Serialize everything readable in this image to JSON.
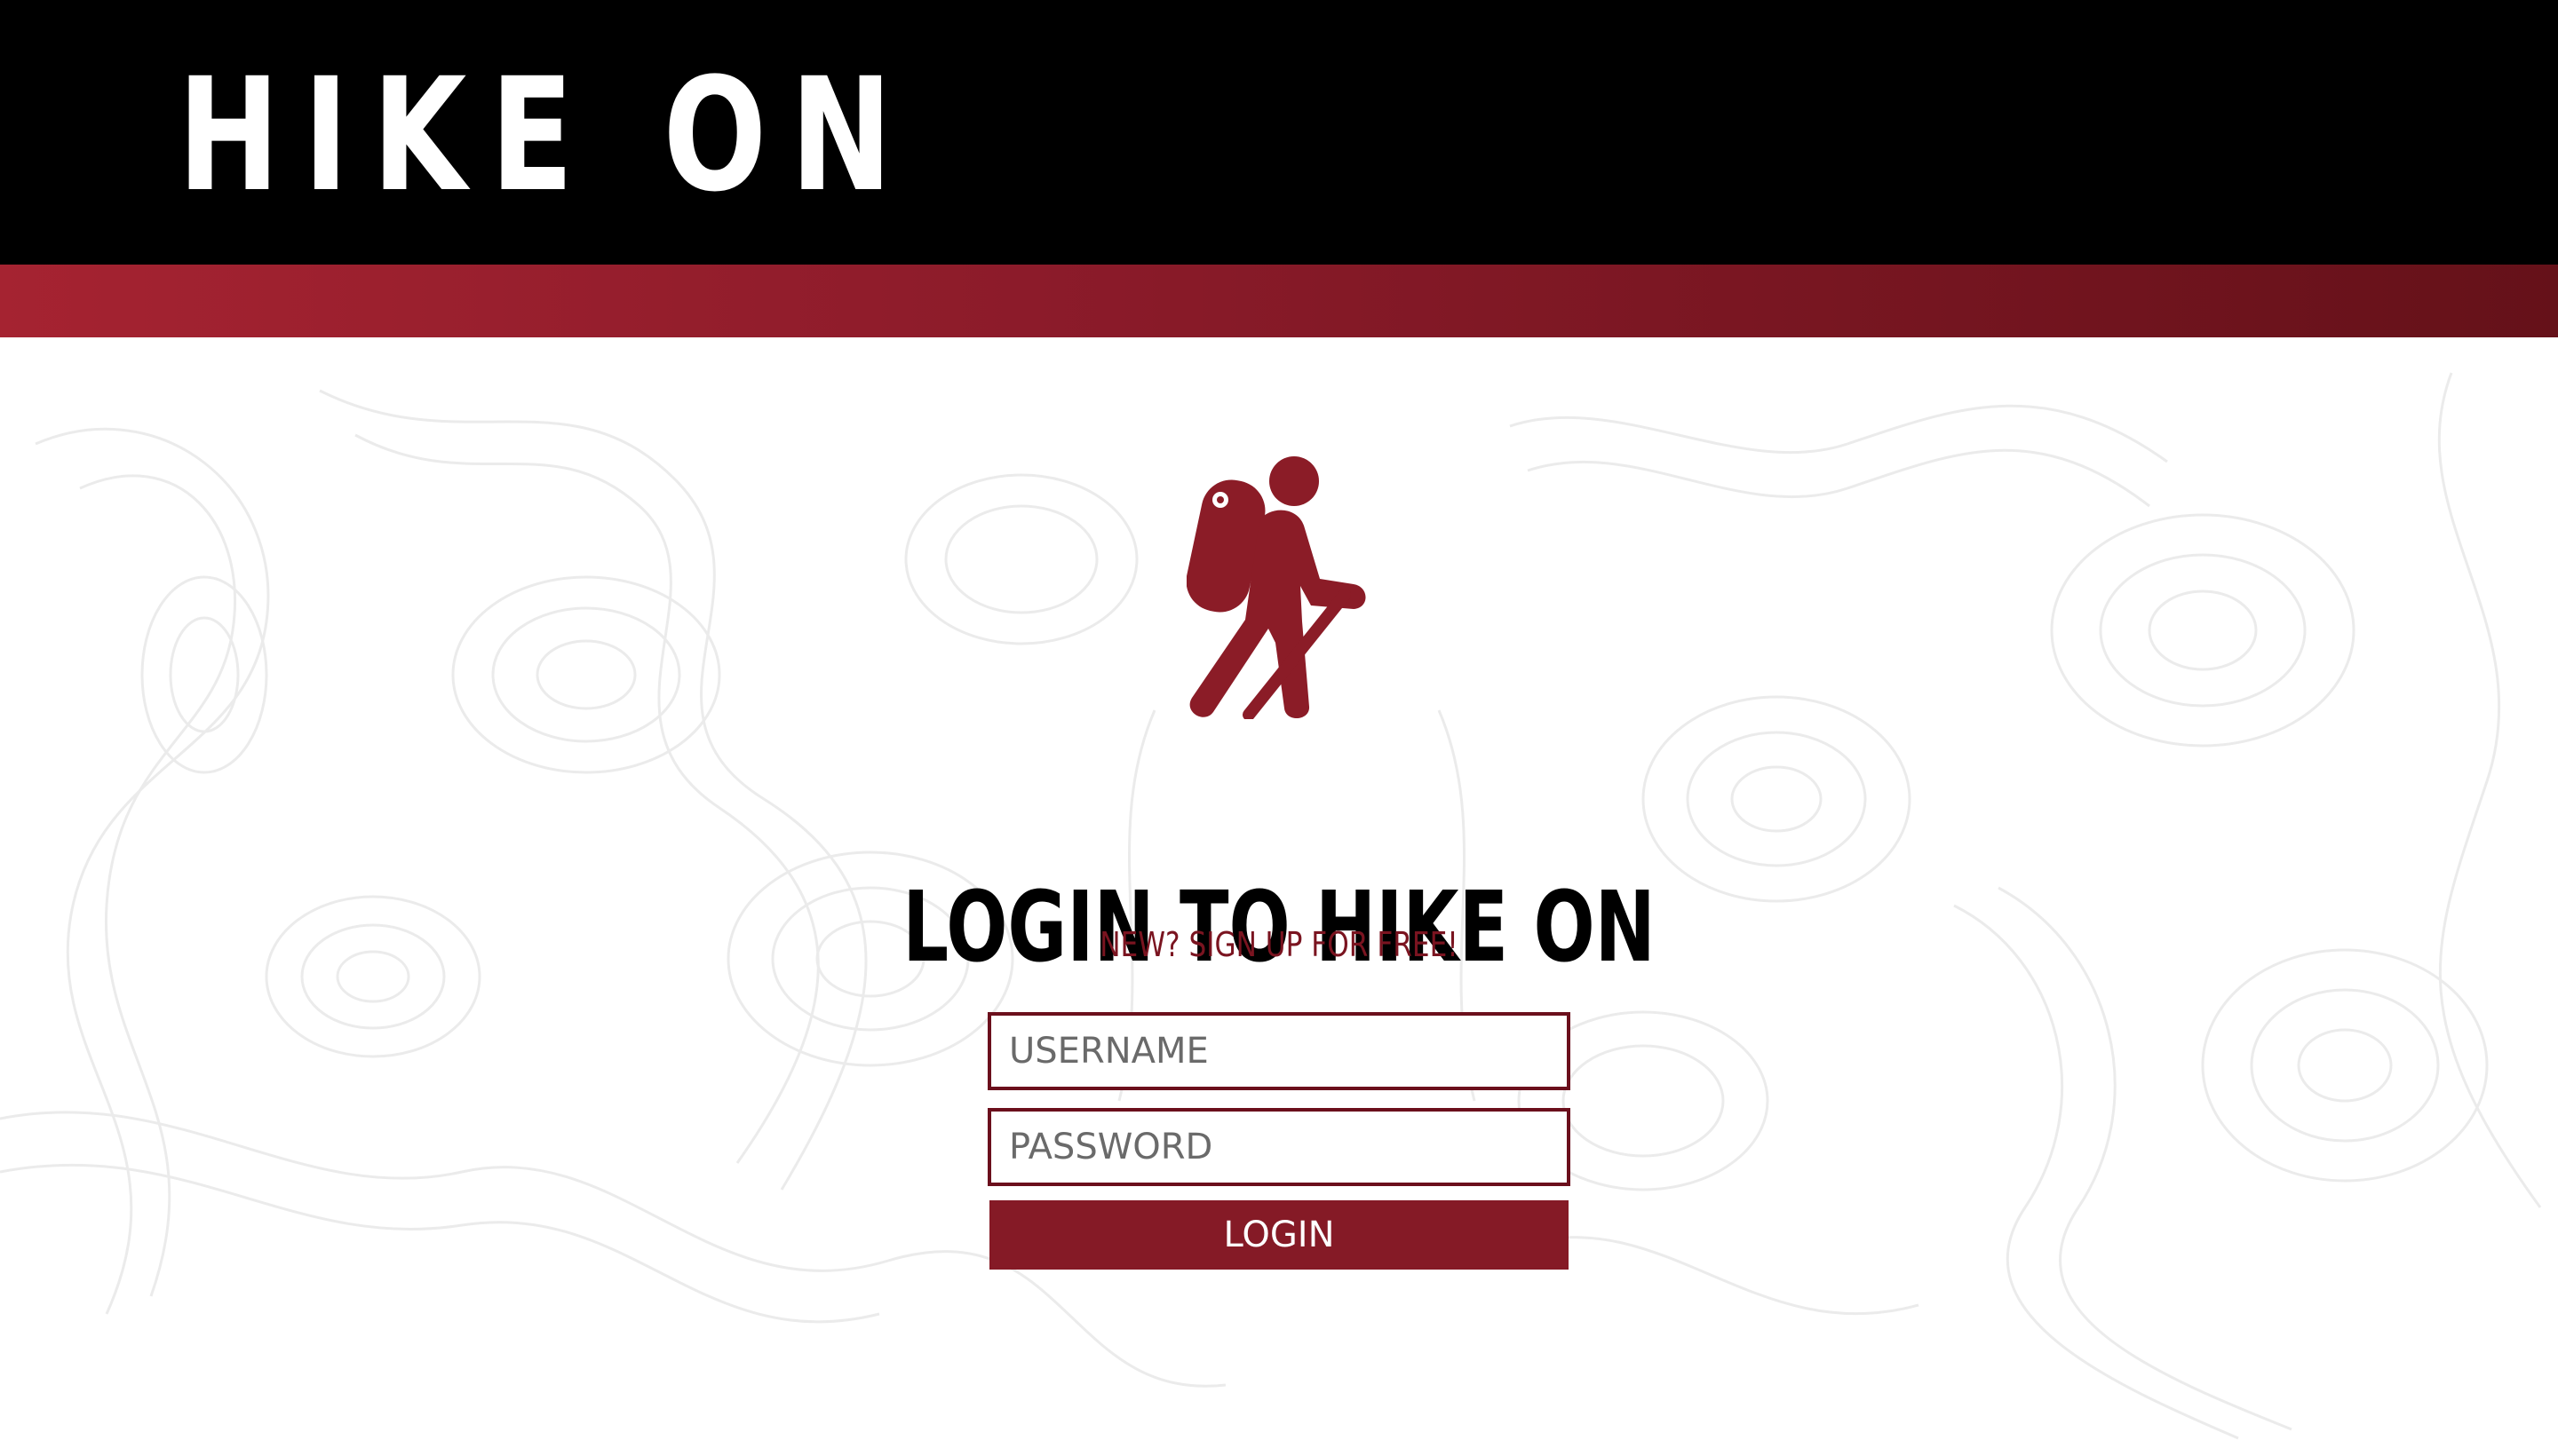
{
  "header": {
    "brand": "HIKE ON"
  },
  "login": {
    "title": "LOGIN TO HIKE ON",
    "signup_link": "NEW? SIGN UP FOR FREE!",
    "username_placeholder": "USERNAME",
    "password_placeholder": "PASSWORD",
    "submit_label": "LOGIN"
  },
  "icons": {
    "hero": "hiker-icon"
  },
  "colors": {
    "header_background": "#000000",
    "accent_stripe_start": "#a52331",
    "accent_stripe_end": "#651119",
    "brand_text": "#ffffff",
    "accent": "#851a26",
    "link_text": "#7a1420",
    "input_border": "#6b0f1c",
    "topo_lines": "#ebebeb"
  }
}
